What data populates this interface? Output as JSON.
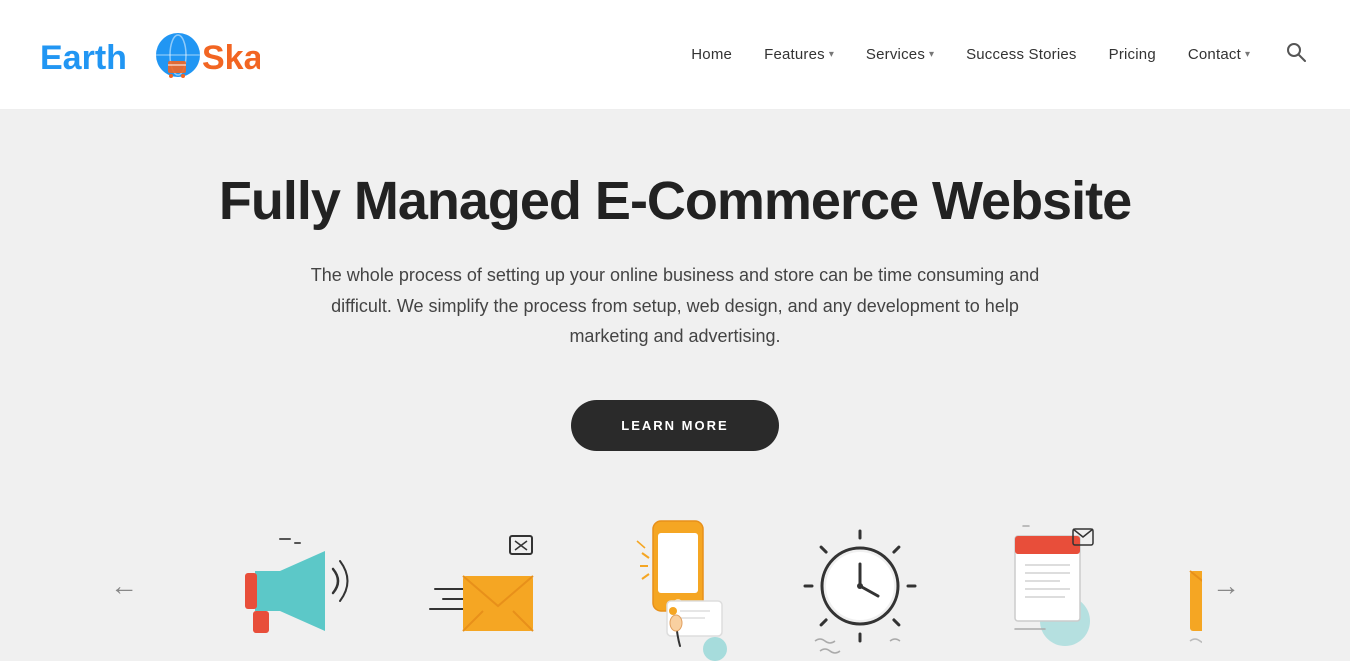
{
  "header": {
    "logo_earth": "Earth",
    "logo_skater": "Skater",
    "nav": {
      "home": "Home",
      "features": "Features",
      "features_arrow": "▾",
      "services": "Services",
      "services_arrow": "▾",
      "success_stories": "Success Stories",
      "pricing": "Pricing",
      "contact": "Contact",
      "contact_arrow": "▾"
    }
  },
  "hero": {
    "title": "Fully Managed E-Commerce Website",
    "description": "The whole process of setting up your online business and store can be time consuming and difficult. We simplify the process from setup, web design, and any development to help marketing and advertising.",
    "cta_button": "LEARN MORE"
  },
  "carousel": {
    "prev_label": "←",
    "next_label": "→"
  }
}
